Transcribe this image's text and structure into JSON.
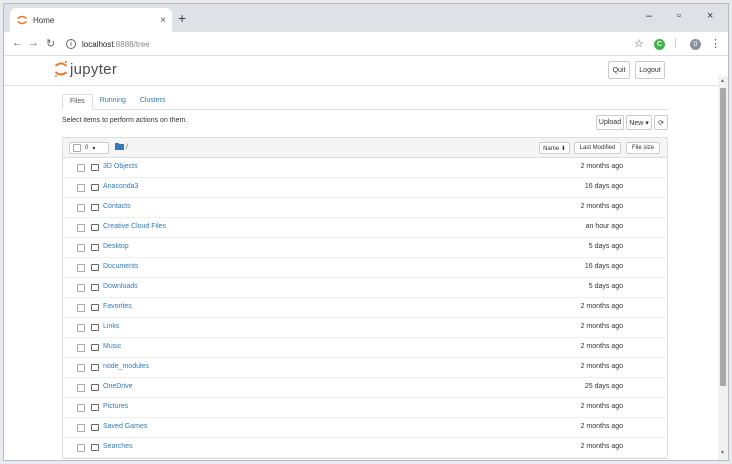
{
  "browser": {
    "tab_title": "Home",
    "tab_close": "×",
    "new_tab": "+",
    "minimize": "–",
    "maximize": "▫",
    "close": "×",
    "url_host": "localhost",
    "url_rest": ":8888/tree",
    "star_icon": "☆",
    "ext_label": "C",
    "profile_label": "0",
    "menu_icon": "⋮"
  },
  "header": {
    "logo_text": "jupyter",
    "quit_label": "Quit",
    "logout_label": "Logout"
  },
  "tabs": [
    "Files",
    "Running",
    "Clusters"
  ],
  "toolbar": {
    "hint": "Select items to perform actions on them.",
    "upload_label": "Upload",
    "new_label": "New ▾",
    "refresh_icon": "⟳"
  },
  "list_header": {
    "select_count": "0",
    "select_caret": "▾",
    "breadcrumb": "/",
    "name_label": "Name ⬇",
    "modified_label": "Last Modified",
    "size_label": "File size"
  },
  "rows": [
    {
      "name": "3D Objects",
      "modified": "2 months ago"
    },
    {
      "name": "Anaconda3",
      "modified": "16 days ago"
    },
    {
      "name": "Contacts",
      "modified": "2 months ago"
    },
    {
      "name": "Creative Cloud Files",
      "modified": "an hour ago"
    },
    {
      "name": "Desktop",
      "modified": "5 days ago"
    },
    {
      "name": "Documents",
      "modified": "16 days ago"
    },
    {
      "name": "Downloads",
      "modified": "5 days ago"
    },
    {
      "name": "Favorites",
      "modified": "2 months ago"
    },
    {
      "name": "Links",
      "modified": "2 months ago"
    },
    {
      "name": "Music",
      "modified": "2 months ago"
    },
    {
      "name": "node_modules",
      "modified": "2 months ago"
    },
    {
      "name": "OneDrive",
      "modified": "25 days ago"
    },
    {
      "name": "Pictures",
      "modified": "2 months ago"
    },
    {
      "name": "Saved Games",
      "modified": "2 months ago"
    },
    {
      "name": "Searches",
      "modified": "2 months ago"
    }
  ],
  "colors": {
    "link": "#337ab7",
    "jupyter_orange": "#f37726"
  }
}
